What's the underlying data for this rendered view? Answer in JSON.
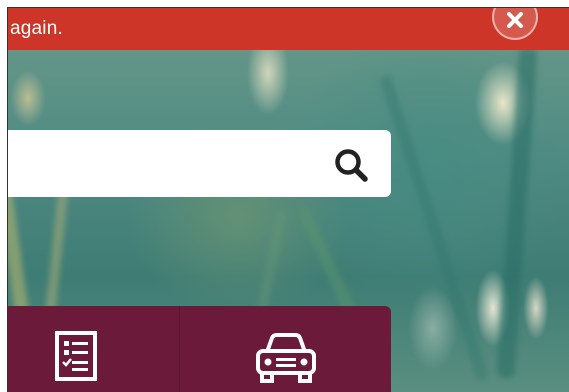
{
  "alert": {
    "message": "again.",
    "close_icon": "close-icon"
  },
  "search": {
    "value": "",
    "placeholder": "",
    "button_icon": "search-icon"
  },
  "tiles": [
    {
      "icon": "checklist-icon"
    },
    {
      "icon": "car-icon"
    }
  ],
  "colors": {
    "alert_bg": "#cc3527",
    "tile_bg": "#6b1a3a",
    "search_bg": "#ffffff",
    "search_icon": "#222222"
  }
}
